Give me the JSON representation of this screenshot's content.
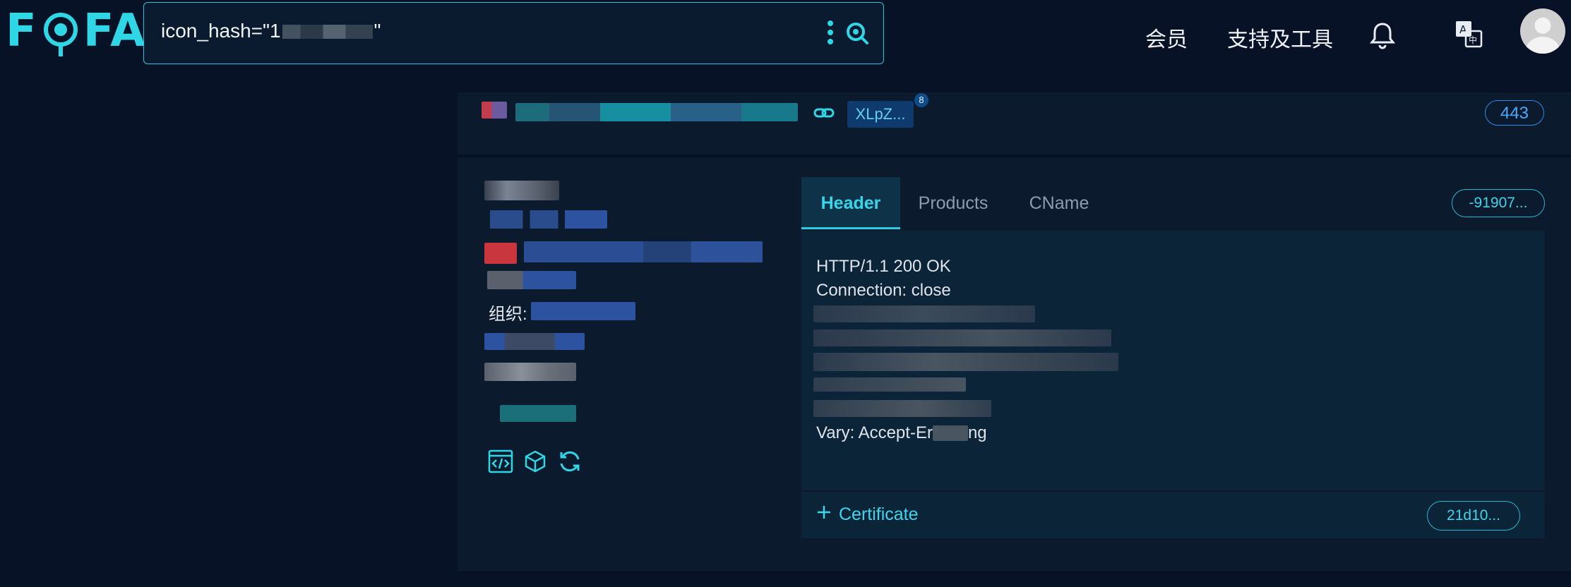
{
  "header": {
    "logo": "FOFA",
    "search": {
      "query_prefix": "icon_hash=\"1",
      "query_suffix": "\""
    },
    "nav": {
      "member": "会员",
      "support_tools": "支持及工具"
    },
    "icons": [
      "more-vertical-icon",
      "search-icon",
      "bell-icon",
      "translate-icon",
      "avatar"
    ]
  },
  "result": {
    "top_card": {
      "tag": "XLpZ...",
      "tag_count": "8",
      "port": "443"
    },
    "info": {
      "org_label": "组织:"
    },
    "tabs": [
      {
        "label": "Header",
        "active": true
      },
      {
        "label": "Products"
      },
      {
        "label": "CName"
      }
    ],
    "header_chip": "-91907...",
    "header_lines": [
      "HTTP/1.1 200 OK",
      "Connection: close",
      "Vary: Accept-Er",
      "ng"
    ],
    "certificate": {
      "label": "Certificate",
      "chip": "21d10..."
    }
  },
  "colors": {
    "accent": "#2fd6e6",
    "background": "#071227",
    "card": "#0c1a2e",
    "link_blue": "#2b8be8"
  }
}
